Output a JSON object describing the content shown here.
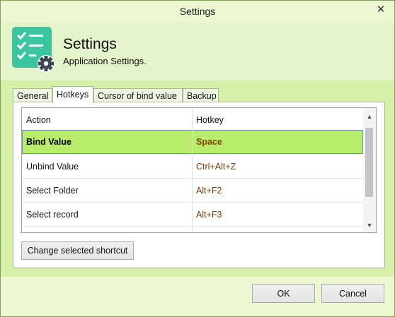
{
  "window": {
    "title": "Settings",
    "close_glyph": "✕"
  },
  "header": {
    "title": "Settings",
    "subtitle": "Application Settings.",
    "icon": "checklist-gear-icon"
  },
  "tabs": [
    {
      "label": "General",
      "active": false
    },
    {
      "label": "Hotkeys",
      "active": true
    },
    {
      "label": "Cursor of bind value",
      "active": false
    },
    {
      "label": "Backup",
      "active": false
    }
  ],
  "grid": {
    "columns": [
      "Action",
      "Hotkey"
    ],
    "rows": [
      {
        "action": "Bind Value",
        "hotkey": "Space",
        "selected": true
      },
      {
        "action": "Unbind Value",
        "hotkey": "Ctrl+Alt+Z",
        "selected": false
      },
      {
        "action": "Select Folder",
        "hotkey": "Alt+F2",
        "selected": false
      },
      {
        "action": "Select record",
        "hotkey": "Alt+F3",
        "selected": false
      }
    ]
  },
  "buttons": {
    "change_shortcut": "Change selected shortcut",
    "ok": "OK",
    "cancel": "Cancel"
  },
  "colors": {
    "accent": "#3cc6a0",
    "selected_row": "#b8ec6a",
    "hotkey_text": "#7a3b0a",
    "panel_green": "#d6f0aa"
  }
}
